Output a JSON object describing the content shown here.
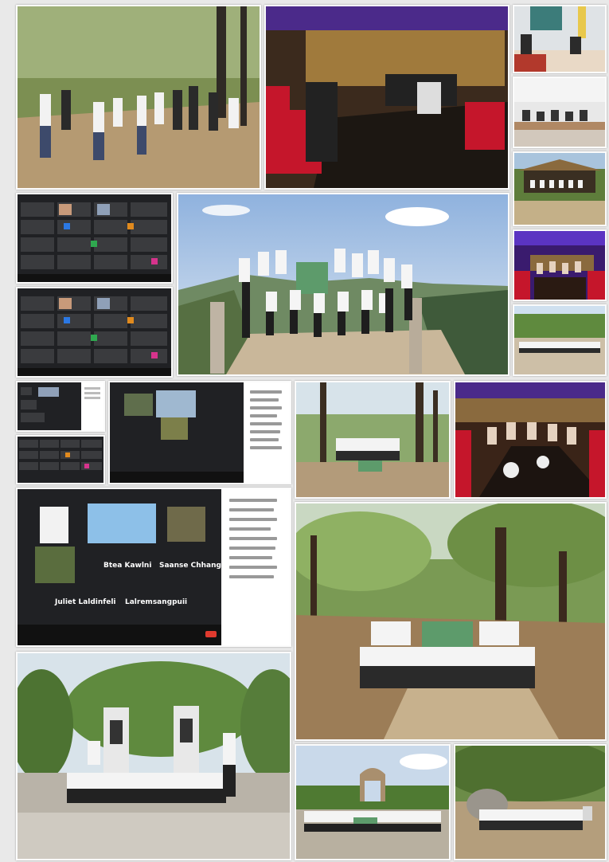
{
  "collage": {
    "photos": [
      {
        "id": "p1",
        "scene": "forest-trail-group"
      },
      {
        "id": "p2",
        "scene": "restaurant-meeting"
      },
      {
        "id": "p3",
        "scene": "office-desk"
      },
      {
        "id": "p4",
        "scene": "classroom"
      },
      {
        "id": "p5",
        "scene": "thatched-hut-group"
      },
      {
        "id": "p6",
        "scene": "restaurant-purple"
      },
      {
        "id": "p7",
        "scene": "campus-group-row"
      },
      {
        "id": "p8",
        "scene": "mountain-summit-group"
      },
      {
        "id": "p9",
        "scene": "forest-small-group"
      },
      {
        "id": "p10",
        "scene": "restaurant-dinner"
      },
      {
        "id": "p11",
        "scene": "forest-large-group"
      },
      {
        "id": "p12",
        "scene": "memorial-group"
      },
      {
        "id": "p13",
        "scene": "arch-gate-group"
      },
      {
        "id": "p14",
        "scene": "rocky-forest-group"
      }
    ],
    "video_call": {
      "participants": [
        "Btea Kawlni",
        "Saanse Chhangte",
        "Juliet Laldinfeli",
        "Lalremsangpuii"
      ]
    }
  },
  "colors": {
    "border": "#fbfbfb",
    "background": "#e9e9e9",
    "call_bg": "#202124",
    "sky": "#bcd3ea",
    "foliage": "#5b7a3a",
    "earth": "#b59a72",
    "shirt": "#f5f5f5",
    "purple": "#3a1b6e"
  }
}
